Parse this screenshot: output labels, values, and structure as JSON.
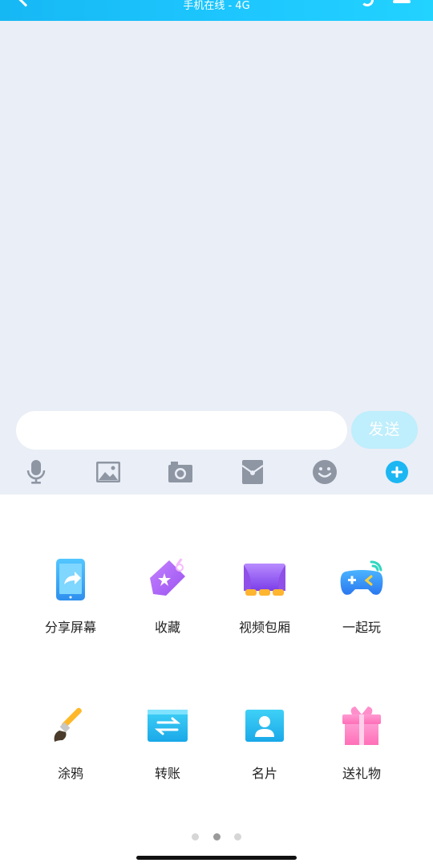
{
  "header": {
    "subtitle": "手机在线 - 4G"
  },
  "input": {
    "send_label": "发送"
  },
  "toolbar": {
    "icons": [
      "microphone-icon",
      "image-icon",
      "camera-icon",
      "red-packet-icon",
      "emoji-icon",
      "plus-icon"
    ],
    "accent": "#1cb7f3"
  },
  "panel": {
    "row1": [
      {
        "label": "分享屏幕",
        "icon": "share-screen-icon"
      },
      {
        "label": "收藏",
        "icon": "favorites-icon"
      },
      {
        "label": "视频包厢",
        "icon": "video-box-icon"
      },
      {
        "label": "一起玩",
        "icon": "play-together-icon"
      }
    ],
    "row2": [
      {
        "label": "涂鸦",
        "icon": "doodle-icon"
      },
      {
        "label": "转账",
        "icon": "transfer-icon"
      },
      {
        "label": "名片",
        "icon": "business-card-icon"
      },
      {
        "label": "送礼物",
        "icon": "gift-icon"
      }
    ]
  },
  "pagination": {
    "pages": 3,
    "active": 2
  }
}
